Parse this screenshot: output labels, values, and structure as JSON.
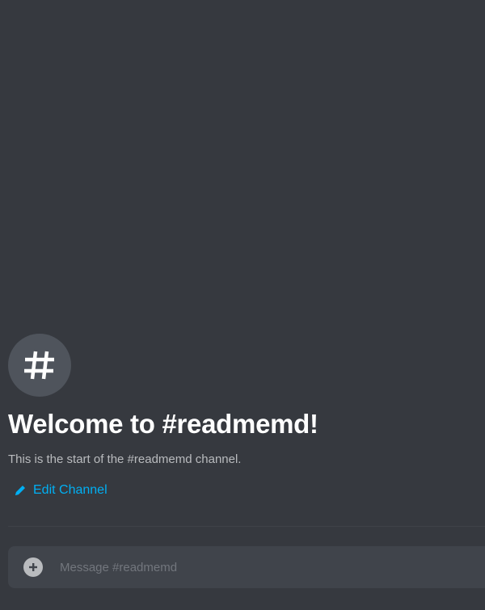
{
  "welcome": {
    "icon": "hashtag-icon",
    "title": "Welcome to #readmemd!",
    "subtitle": "This is the start of the #readmemd channel.",
    "edit_icon": "pencil-icon",
    "edit_label": "Edit Channel"
  },
  "composer": {
    "add_icon": "plus-circle-icon",
    "placeholder": "Message #readmemd",
    "value": ""
  },
  "colors": {
    "background": "#36393f",
    "avatar": "#4f545c",
    "composer": "#40444b",
    "link": "#00aff4",
    "title": "#ffffff",
    "subtitle": "#b9bbbe"
  }
}
